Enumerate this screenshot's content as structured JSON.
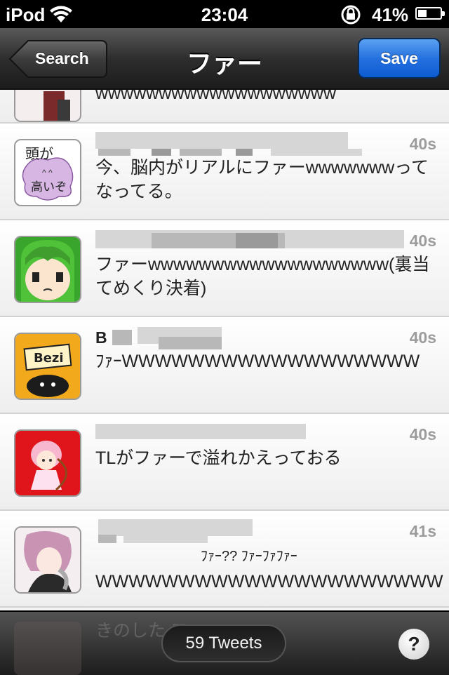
{
  "status_bar": {
    "carrier": "iPod",
    "time": "23:04",
    "battery": "41%",
    "battery_level": 0.41
  },
  "nav": {
    "back_label": "Search",
    "title": "ファー",
    "save_label": "Save"
  },
  "partial_row": {
    "text": "wwwwwwwwwwwwwwwwwww"
  },
  "tweets": [
    {
      "name_visible": "",
      "handle_visible": "",
      "time": "40s",
      "text": "今、脳内がリアルにファーwwwwwwwってなってる。",
      "avatar_text_top": "頭が",
      "avatar_text_bottom": "高いぞ"
    },
    {
      "name_visible": "",
      "handle_visible": "",
      "time": "40s",
      "text": "ファーwwwwwwwwwwwwwwwwwww(裏当てめくり決着)"
    },
    {
      "name_visible": "",
      "handle_visible": "",
      "time": "40s",
      "text": "ﾌｧｰWWWWWWWWWWWWWWWWWW",
      "avatar_text": "Bezi"
    },
    {
      "name_visible": "",
      "handle_visible": "",
      "time": "40s",
      "text": "TLがファーで溢れかえっておる"
    },
    {
      "name_visible": "",
      "handle_visible": "",
      "time": "41s",
      "text_line1": "ﾌｧｰ?? ﾌｧｰﾌｧﾌｧｰ",
      "text_line2": "WWWWWWWWWWWWWWWWWWWWW"
    }
  ],
  "toolbar": {
    "ghost_text": "きのした ファー",
    "tweet_count": "59 Tweets",
    "help": "?"
  }
}
